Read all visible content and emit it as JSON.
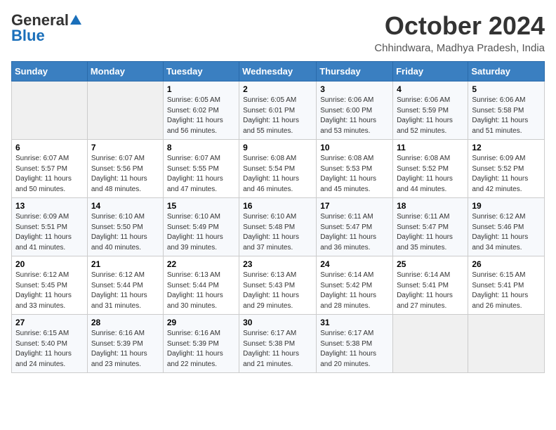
{
  "header": {
    "logo_general": "General",
    "logo_blue": "Blue",
    "month": "October 2024",
    "location": "Chhindwara, Madhya Pradesh, India"
  },
  "days_of_week": [
    "Sunday",
    "Monday",
    "Tuesday",
    "Wednesday",
    "Thursday",
    "Friday",
    "Saturday"
  ],
  "weeks": [
    [
      {
        "day": "",
        "sunrise": "",
        "sunset": "",
        "daylight": ""
      },
      {
        "day": "",
        "sunrise": "",
        "sunset": "",
        "daylight": ""
      },
      {
        "day": "1",
        "sunrise": "Sunrise: 6:05 AM",
        "sunset": "Sunset: 6:02 PM",
        "daylight": "Daylight: 11 hours and 56 minutes."
      },
      {
        "day": "2",
        "sunrise": "Sunrise: 6:05 AM",
        "sunset": "Sunset: 6:01 PM",
        "daylight": "Daylight: 11 hours and 55 minutes."
      },
      {
        "day": "3",
        "sunrise": "Sunrise: 6:06 AM",
        "sunset": "Sunset: 6:00 PM",
        "daylight": "Daylight: 11 hours and 53 minutes."
      },
      {
        "day": "4",
        "sunrise": "Sunrise: 6:06 AM",
        "sunset": "Sunset: 5:59 PM",
        "daylight": "Daylight: 11 hours and 52 minutes."
      },
      {
        "day": "5",
        "sunrise": "Sunrise: 6:06 AM",
        "sunset": "Sunset: 5:58 PM",
        "daylight": "Daylight: 11 hours and 51 minutes."
      }
    ],
    [
      {
        "day": "6",
        "sunrise": "Sunrise: 6:07 AM",
        "sunset": "Sunset: 5:57 PM",
        "daylight": "Daylight: 11 hours and 50 minutes."
      },
      {
        "day": "7",
        "sunrise": "Sunrise: 6:07 AM",
        "sunset": "Sunset: 5:56 PM",
        "daylight": "Daylight: 11 hours and 48 minutes."
      },
      {
        "day": "8",
        "sunrise": "Sunrise: 6:07 AM",
        "sunset": "Sunset: 5:55 PM",
        "daylight": "Daylight: 11 hours and 47 minutes."
      },
      {
        "day": "9",
        "sunrise": "Sunrise: 6:08 AM",
        "sunset": "Sunset: 5:54 PM",
        "daylight": "Daylight: 11 hours and 46 minutes."
      },
      {
        "day": "10",
        "sunrise": "Sunrise: 6:08 AM",
        "sunset": "Sunset: 5:53 PM",
        "daylight": "Daylight: 11 hours and 45 minutes."
      },
      {
        "day": "11",
        "sunrise": "Sunrise: 6:08 AM",
        "sunset": "Sunset: 5:52 PM",
        "daylight": "Daylight: 11 hours and 44 minutes."
      },
      {
        "day": "12",
        "sunrise": "Sunrise: 6:09 AM",
        "sunset": "Sunset: 5:52 PM",
        "daylight": "Daylight: 11 hours and 42 minutes."
      }
    ],
    [
      {
        "day": "13",
        "sunrise": "Sunrise: 6:09 AM",
        "sunset": "Sunset: 5:51 PM",
        "daylight": "Daylight: 11 hours and 41 minutes."
      },
      {
        "day": "14",
        "sunrise": "Sunrise: 6:10 AM",
        "sunset": "Sunset: 5:50 PM",
        "daylight": "Daylight: 11 hours and 40 minutes."
      },
      {
        "day": "15",
        "sunrise": "Sunrise: 6:10 AM",
        "sunset": "Sunset: 5:49 PM",
        "daylight": "Daylight: 11 hours and 39 minutes."
      },
      {
        "day": "16",
        "sunrise": "Sunrise: 6:10 AM",
        "sunset": "Sunset: 5:48 PM",
        "daylight": "Daylight: 11 hours and 37 minutes."
      },
      {
        "day": "17",
        "sunrise": "Sunrise: 6:11 AM",
        "sunset": "Sunset: 5:47 PM",
        "daylight": "Daylight: 11 hours and 36 minutes."
      },
      {
        "day": "18",
        "sunrise": "Sunrise: 6:11 AM",
        "sunset": "Sunset: 5:47 PM",
        "daylight": "Daylight: 11 hours and 35 minutes."
      },
      {
        "day": "19",
        "sunrise": "Sunrise: 6:12 AM",
        "sunset": "Sunset: 5:46 PM",
        "daylight": "Daylight: 11 hours and 34 minutes."
      }
    ],
    [
      {
        "day": "20",
        "sunrise": "Sunrise: 6:12 AM",
        "sunset": "Sunset: 5:45 PM",
        "daylight": "Daylight: 11 hours and 33 minutes."
      },
      {
        "day": "21",
        "sunrise": "Sunrise: 6:12 AM",
        "sunset": "Sunset: 5:44 PM",
        "daylight": "Daylight: 11 hours and 31 minutes."
      },
      {
        "day": "22",
        "sunrise": "Sunrise: 6:13 AM",
        "sunset": "Sunset: 5:44 PM",
        "daylight": "Daylight: 11 hours and 30 minutes."
      },
      {
        "day": "23",
        "sunrise": "Sunrise: 6:13 AM",
        "sunset": "Sunset: 5:43 PM",
        "daylight": "Daylight: 11 hours and 29 minutes."
      },
      {
        "day": "24",
        "sunrise": "Sunrise: 6:14 AM",
        "sunset": "Sunset: 5:42 PM",
        "daylight": "Daylight: 11 hours and 28 minutes."
      },
      {
        "day": "25",
        "sunrise": "Sunrise: 6:14 AM",
        "sunset": "Sunset: 5:41 PM",
        "daylight": "Daylight: 11 hours and 27 minutes."
      },
      {
        "day": "26",
        "sunrise": "Sunrise: 6:15 AM",
        "sunset": "Sunset: 5:41 PM",
        "daylight": "Daylight: 11 hours and 26 minutes."
      }
    ],
    [
      {
        "day": "27",
        "sunrise": "Sunrise: 6:15 AM",
        "sunset": "Sunset: 5:40 PM",
        "daylight": "Daylight: 11 hours and 24 minutes."
      },
      {
        "day": "28",
        "sunrise": "Sunrise: 6:16 AM",
        "sunset": "Sunset: 5:39 PM",
        "daylight": "Daylight: 11 hours and 23 minutes."
      },
      {
        "day": "29",
        "sunrise": "Sunrise: 6:16 AM",
        "sunset": "Sunset: 5:39 PM",
        "daylight": "Daylight: 11 hours and 22 minutes."
      },
      {
        "day": "30",
        "sunrise": "Sunrise: 6:17 AM",
        "sunset": "Sunset: 5:38 PM",
        "daylight": "Daylight: 11 hours and 21 minutes."
      },
      {
        "day": "31",
        "sunrise": "Sunrise: 6:17 AM",
        "sunset": "Sunset: 5:38 PM",
        "daylight": "Daylight: 11 hours and 20 minutes."
      },
      {
        "day": "",
        "sunrise": "",
        "sunset": "",
        "daylight": ""
      },
      {
        "day": "",
        "sunrise": "",
        "sunset": "",
        "daylight": ""
      }
    ]
  ]
}
